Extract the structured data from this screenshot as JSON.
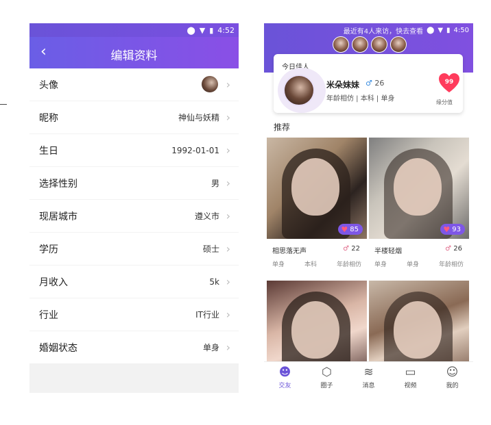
{
  "left": {
    "status_time": "4:52",
    "title": "编辑资料",
    "rows": [
      {
        "label": "头像",
        "value": ""
      },
      {
        "label": "昵称",
        "value": "神仙与妖精"
      },
      {
        "label": "生日",
        "value": "1992-01-01"
      },
      {
        "label": "选择性别",
        "value": "男"
      },
      {
        "label": "现居城市",
        "value": "遵义市"
      },
      {
        "label": "学历",
        "value": "硕士"
      },
      {
        "label": "月收入",
        "value": "5k"
      },
      {
        "label": "行业",
        "value": "IT行业"
      },
      {
        "label": "婚姻状态",
        "value": "单身"
      }
    ]
  },
  "right": {
    "status_notice": "最近有4人来访，快去查看",
    "status_time": "4:50",
    "today": {
      "tag": "今日佳人",
      "name": "米朵妹妹",
      "age": "26",
      "sub": "年龄相仿  |  本科  |  单身",
      "score": "99",
      "score_label": "缘分值"
    },
    "recommend_title": "推荐",
    "tiles": [
      {
        "name": "相思落无声",
        "age": "22",
        "score": "85",
        "meta": [
          "单身",
          "本科",
          "年龄相仿"
        ]
      },
      {
        "name": "半楼轻烟",
        "age": "26",
        "score": "93",
        "meta": [
          "单身",
          "单身",
          "年龄相仿"
        ]
      },
      {
        "name": "",
        "age": "",
        "score": "",
        "meta": []
      },
      {
        "name": "",
        "age": "",
        "score": "",
        "meta": []
      }
    ],
    "tabs": [
      {
        "label": "交友",
        "icon": "chat-face-icon"
      },
      {
        "label": "圈子",
        "icon": "hexagon-icon"
      },
      {
        "label": "消息",
        "icon": "layers-icon"
      },
      {
        "label": "视频",
        "icon": "video-icon"
      },
      {
        "label": "我的",
        "icon": "person-icon"
      }
    ]
  },
  "colors": {
    "accent": "#6a53d8",
    "heart": "#ff3b5c"
  }
}
